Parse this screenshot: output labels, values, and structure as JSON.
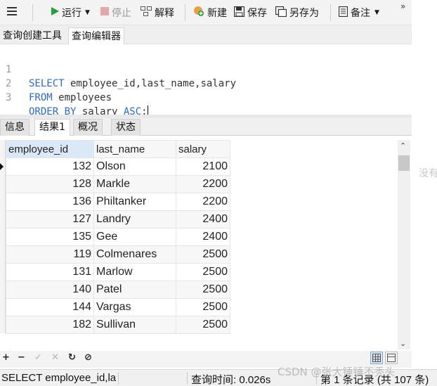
{
  "toolbar": {
    "run_label": "运行",
    "stop_label": "停止",
    "explain_label": "解释",
    "new_label": "新建",
    "save_label": "保存",
    "save_as_label": "另存为",
    "notes_label": "备注",
    "overflow_label": "»"
  },
  "editor_tabs": [
    {
      "label": "查询创建工具",
      "active": false
    },
    {
      "label": "查询编辑器",
      "active": true
    }
  ],
  "editor": {
    "lines": [
      {
        "num": "1",
        "kw1": "SELECT",
        "rest1": " employee_id,last_name,salary",
        "kw2": "",
        "rest2": ""
      },
      {
        "num": "2",
        "kw1": "FROM",
        "rest1": " employees",
        "kw2": "",
        "rest2": ""
      },
      {
        "num": "3",
        "kw1": "ORDER BY",
        "rest1": " salary ",
        "kw2": "ASC",
        "rest2": ";"
      }
    ]
  },
  "result_tabs": [
    {
      "label": "信息",
      "active": false
    },
    {
      "label": "结果1",
      "active": true
    },
    {
      "label": "概况",
      "active": false
    },
    {
      "label": "状态",
      "active": false
    }
  ],
  "grid": {
    "columns": [
      "employee_id",
      "last_name",
      "salary"
    ],
    "rows": [
      [
        "132",
        "Olson",
        "2100"
      ],
      [
        "128",
        "Markle",
        "2200"
      ],
      [
        "136",
        "Philtanker",
        "2200"
      ],
      [
        "127",
        "Landry",
        "2400"
      ],
      [
        "135",
        "Gee",
        "2400"
      ],
      [
        "119",
        "Colmenares",
        "2500"
      ],
      [
        "131",
        "Marlow",
        "2500"
      ],
      [
        "140",
        "Patel",
        "2500"
      ],
      [
        "144",
        "Vargas",
        "2500"
      ],
      [
        "182",
        "Sullivan",
        "2500"
      ]
    ]
  },
  "bottom_toolbar": {
    "add": "+",
    "remove": "−",
    "apply": "✓",
    "discard": "✕",
    "refresh": "↻",
    "stop": "⊘"
  },
  "status": {
    "query_text": "SELECT employee_id,la",
    "query_time": "查询时间: 0.026s",
    "record_info": "第 1 条记录 (共 107 条)"
  },
  "side_text": "没有",
  "watermark": "CSDN @张大锤锤不秃头",
  "colors": {
    "keyword": "#2a6ad0",
    "run_icon": "#22a03a",
    "selected_header": "#dbe8f7"
  }
}
